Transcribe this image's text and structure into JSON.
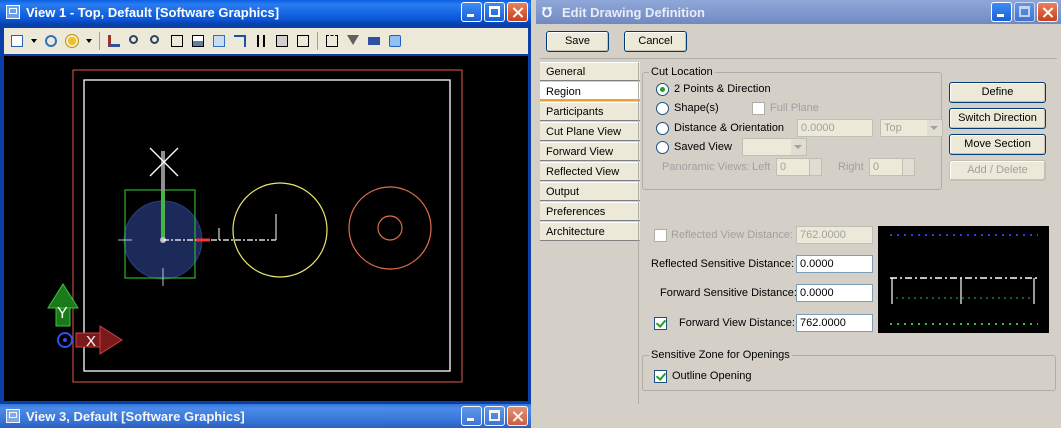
{
  "view1": {
    "title": "View 1 - Top, Default [Software Graphics]",
    "toolbar_icons": [
      "view-attributes-icon",
      "dropdown-arrow-icon",
      "display-style-icon",
      "lighting-icon",
      "dropdown-arrow-icon",
      "update-view-icon",
      "zoom-in-icon",
      "zoom-out-icon",
      "window-area-icon",
      "fit-view-icon",
      "rotate-view-icon",
      "pan-view-icon",
      "view-previous-icon",
      "view-next-icon",
      "copy-view-icon",
      "clip-volume-icon",
      "clip-mask-icon",
      "camera-icon",
      "view-toggles-icon"
    ],
    "axis_x": "X",
    "axis_y": "Y"
  },
  "view3": {
    "title": "View 3, Default [Software Graphics]"
  },
  "dialog": {
    "title": "Edit Drawing Definition",
    "save_label": "Save",
    "cancel_label": "Cancel",
    "tabs": [
      {
        "label": "General"
      },
      {
        "label": "Region"
      },
      {
        "label": "Participants"
      },
      {
        "label": "Cut Plane View"
      },
      {
        "label": "Forward View"
      },
      {
        "label": "Reflected View"
      },
      {
        "label": "Output"
      },
      {
        "label": "Preferences"
      },
      {
        "label": "Architecture"
      }
    ],
    "active_tab": "Region",
    "cut_location": {
      "title": "Cut Location",
      "option_2points": "2 Points & Direction",
      "option_shapes": "Shape(s)",
      "full_plane": "Full Plane",
      "option_distance": "Distance & Orientation",
      "distance_value": "0.0000",
      "orientation_value": "Top",
      "option_saved_view": "Saved View",
      "saved_view_value": "",
      "panoramic_label": "Panoramic Views:",
      "left_label": "Left",
      "left_value": "0",
      "right_label": "Right",
      "right_value": "0",
      "selected_option": "2 Points & Direction"
    },
    "side_buttons": {
      "define": "Define",
      "switch_direction": "Switch Direction",
      "move_section": "Move Section",
      "add_delete": "Add / Delete"
    },
    "distances": {
      "reflected_view_label": "Reflected View Distance:",
      "reflected_view_value": "762.0000",
      "reflected_view_checked": false,
      "reflected_sensitive_label": "Reflected Sensitive Distance:",
      "reflected_sensitive_value": "0.0000",
      "forward_sensitive_label": "Forward Sensitive Distance:",
      "forward_sensitive_value": "0.0000",
      "forward_view_label": "Forward View Distance:",
      "forward_view_value": "762.0000",
      "forward_view_checked": true
    },
    "sensitive_zone": {
      "title": "Sensitive Zone for Openings",
      "outline_opening": "Outline Opening",
      "outline_checked": true
    }
  }
}
